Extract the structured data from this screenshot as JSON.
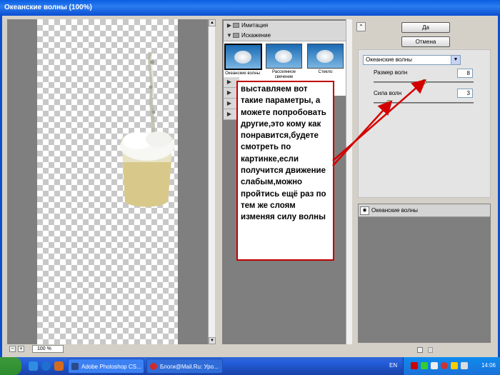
{
  "window": {
    "title": "Океанские волны (100%)"
  },
  "preview": {
    "zoom": "100 %",
    "zoom_out": "−",
    "zoom_in": "+"
  },
  "gallery": {
    "categories": [
      {
        "label": "Имитация",
        "expanded": false
      },
      {
        "label": "Искажение",
        "expanded": true
      }
    ],
    "thumbnails": [
      {
        "label": "Океанские волны",
        "selected": true
      },
      {
        "label": "Рассеянное свечение",
        "selected": false
      },
      {
        "label": "Стекло",
        "selected": false
      }
    ]
  },
  "buttons": {
    "ok": "Да",
    "cancel": "Отмена",
    "collapse": "⌃"
  },
  "filter": {
    "selected": "Океанские волны",
    "params": [
      {
        "label": "Размер волн",
        "value": "8"
      },
      {
        "label": "Сила волн",
        "value": "3"
      }
    ]
  },
  "layers": {
    "effect_layer": "Океанские волны"
  },
  "annotation": {
    "text": "выставляем вот такие параметры, а можете попробовать другие,это кому как понравится,будете смотреть по картинке,если получится движение слабым,можно пройтись ещё раз по тем же слоям изменяя силу волны"
  },
  "taskbar": {
    "tasks": [
      {
        "label": "Adobe Photoshop CS..."
      },
      {
        "label": "Блоги@Mail.Ru: Уро..."
      }
    ],
    "language": "EN",
    "clock": "14:06"
  },
  "colors": {
    "accent": "#245edb",
    "annotation_border": "#c00000",
    "arrow": "#d40000"
  }
}
